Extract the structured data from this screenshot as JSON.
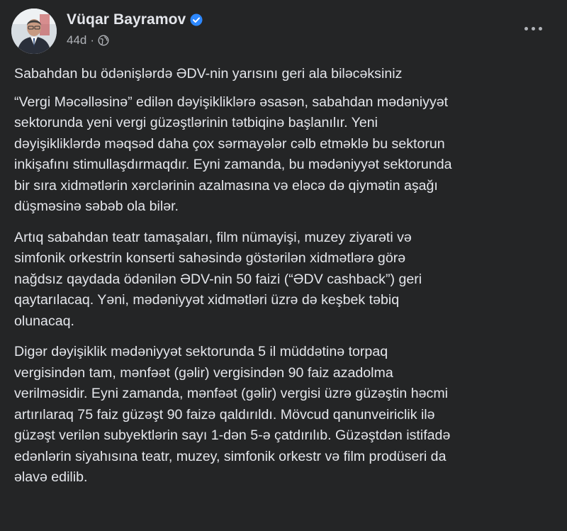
{
  "post": {
    "author": "Vüqar Bayramov",
    "timestamp": "44d",
    "separator": "·",
    "verified_icon": "verified-badge-icon",
    "privacy_icon": "globe-icon",
    "more_icon": "more-options-icon",
    "colors": {
      "background": "#242526",
      "text": "#e4e6eb",
      "secondary_text": "#b0b3b8",
      "verified": "#2d88ff"
    },
    "paragraphs": [
      "Sabahdan bu ödənişlərdə ƏDV-nin yarısını geri ala biləcəksiniz",
      "“Vergi Məcəlləsinə” edilən dəyişikliklərə əsasən, sabahdan mədəniyyət\nsektorunda yeni vergi güzəştlərinin tətbiqinə başlanılır. Yeni\ndəyişikliklərdə məqsəd daha çox sərmayələr cəlb etməklə bu sektorun\ninkişafını stimullaşdırmaqdır. Eyni zamanda, bu mədəniyyət sektorunda\nbir sıra xidmətlərin xərclərinin azalmasına və eləcə də qiymətin aşağı\ndüşməsinə səbəb ola bilər.",
      "Artıq sabahdan teatr tamaşaları, film nümayişi, muzey ziyarəti və\nsimfonik orkestrin konserti sahəsində göstərilən xidmətlərə görə\nnağdsız qaydada ödənilən ƏDV-nin 50 faizi (“ƏDV cashback”) geri\nqaytarılacaq. Yəni, mədəniyyət xidmətləri üzrə də keşbek təbiq\nolunacaq.",
      "Digər dəyişiklik mədəniyyət sektorunda 5 il müddətinə torpaq\nvergisindən tam, mənfəət (gəlir) vergisindən 90 faiz azadolma\nverilməsidir. Eyni zamanda, mənfəət (gəlir) vergisi üzrə güzəştin həcmi\nartırılaraq 75 faiz güzəşt 90 faizə qaldırıldı. Mövcud qanunveiriclik ilə\ngüzəşt verilən subyektlərin sayı 1-dən 5-ə çatdırılıb. Güzəştdən istifadə\nedənlərin siyahısına teatr, muzey, simfonik orkestr və film prodüseri da\nəlavə edilib."
    ]
  }
}
